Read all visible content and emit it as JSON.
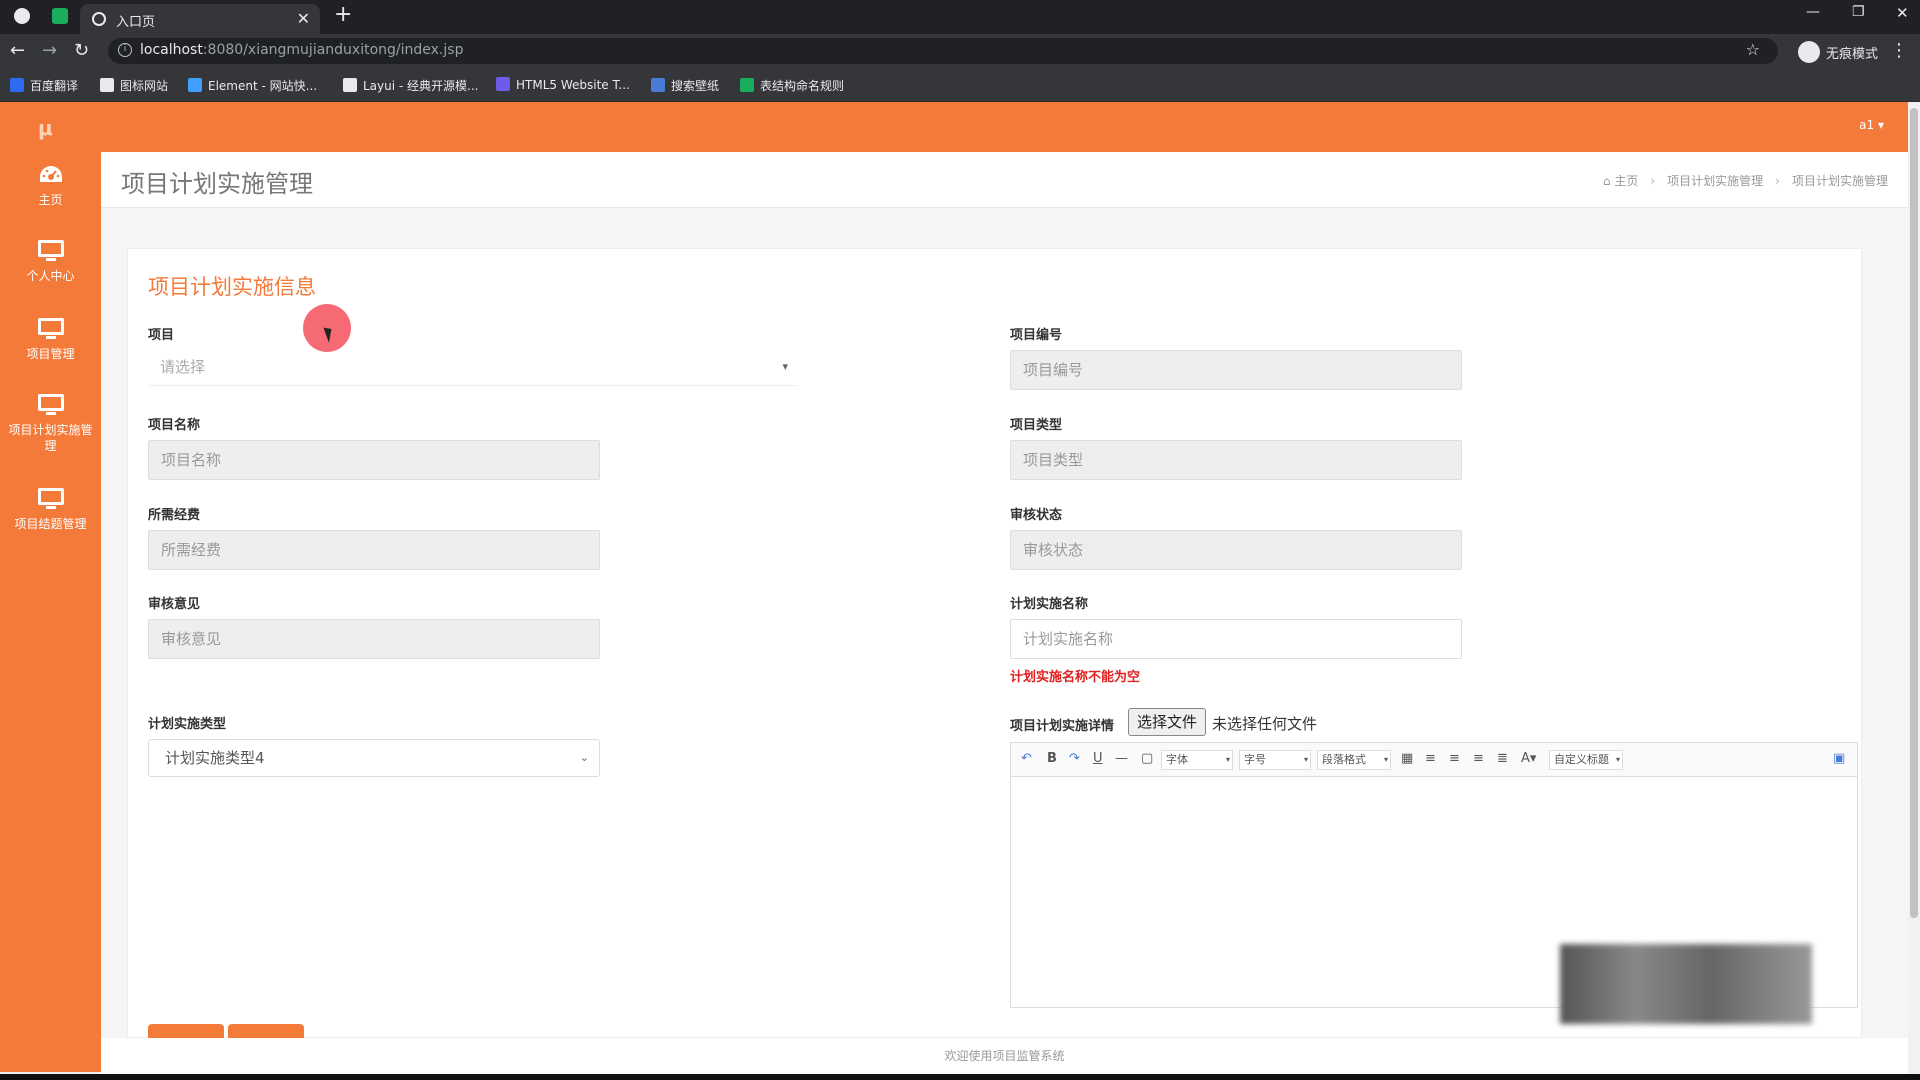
{
  "browser": {
    "tab_title": "入口页",
    "url_host": "localhost",
    "url_path": ":8080/xiangmujianduxitong/index.jsp",
    "incognito_label": "无痕模式",
    "bookmarks": [
      {
        "label": "百度翻译",
        "color": "#2f6bf0"
      },
      {
        "label": "图标网站",
        "color": "#e8eaed"
      },
      {
        "label": "Element - 网站快...",
        "color": "#409eff"
      },
      {
        "label": "Layui - 经典开源模...",
        "color": "#e8eaed"
      },
      {
        "label": "HTML5 Website T...",
        "color": "#6c5ce7"
      },
      {
        "label": "搜索壁纸",
        "color": "#4a7bd6"
      },
      {
        "label": "表结构命名规则",
        "color": "#1aad5b"
      }
    ]
  },
  "app": {
    "accent_color": "#f47a3a",
    "logo": "μ",
    "user": "a1 ▾",
    "sidebar": [
      {
        "label": "主页",
        "icon": "dashboard-icon"
      },
      {
        "label": "个人中心",
        "icon": "monitor-icon"
      },
      {
        "label": "项目管理",
        "icon": "monitor-icon"
      },
      {
        "label": "项目计划实施管理",
        "icon": "monitor-icon"
      },
      {
        "label": "项目结题管理",
        "icon": "monitor-icon"
      }
    ],
    "page_title": "项目计划实施管理",
    "breadcrumb": [
      "主页",
      "项目计划实施管理",
      "项目计划实施管理"
    ],
    "footer": "欢迎使用项目监管系统"
  },
  "form": {
    "title": "项目计划实施信息",
    "project": {
      "label": "项目",
      "placeholder": "请选择"
    },
    "project_no": {
      "label": "项目编号",
      "placeholder": "项目编号"
    },
    "project_name": {
      "label": "项目名称",
      "placeholder": "项目名称"
    },
    "project_type": {
      "label": "项目类型",
      "placeholder": "项目类型"
    },
    "funds": {
      "label": "所需经费",
      "placeholder": "所需经费"
    },
    "review_status": {
      "label": "审核状态",
      "placeholder": "审核状态"
    },
    "review_opinion": {
      "label": "审核意见",
      "placeholder": "审核意见"
    },
    "plan_name": {
      "label": "计划实施名称",
      "placeholder": "计划实施名称",
      "error": "计划实施名称不能为空"
    },
    "plan_type": {
      "label": "计划实施类型",
      "value": "计划实施类型4"
    },
    "details": {
      "label": "项目计划实施详情",
      "file_button": "选择文件",
      "file_status": "未选择任何文件"
    },
    "editor_toolbar": {
      "font": "字体",
      "size": "字号",
      "paragraph": "段落格式",
      "custom_title": "自定义标题"
    }
  }
}
